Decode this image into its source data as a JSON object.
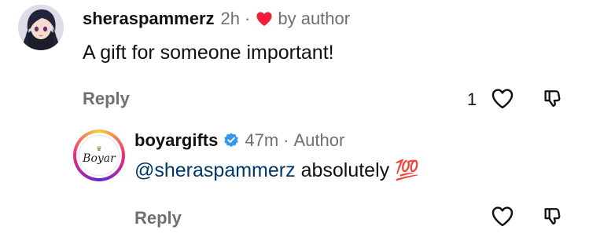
{
  "comment": {
    "username": "sheraspammerz",
    "time": "2h",
    "separator": "·",
    "liked_label": "by author",
    "text": "A gift for someone important!",
    "reply_label": "Reply",
    "like_count": "1"
  },
  "reply": {
    "username": "boyargifts",
    "verified": true,
    "time": "47m",
    "separator": "·",
    "role": "Author",
    "mention": "@sheraspammerz",
    "text": "absolutely",
    "emoji": "💯",
    "reply_label": "Reply",
    "avatar_logo_text": "Boyar"
  },
  "colors": {
    "heart": "#ed1f3a",
    "verified": "#3797f0",
    "mention": "#00376b",
    "muted": "#6f6f74",
    "story_ring_start": "#f9ce34",
    "story_ring_mid": "#ee2a7b",
    "story_ring_end": "#6228d7"
  },
  "icons": {
    "like": "heart-outline-icon",
    "dislike": "thumbs-down-icon",
    "author_liked": "heart-filled-icon",
    "verified": "verified-badge-icon"
  }
}
